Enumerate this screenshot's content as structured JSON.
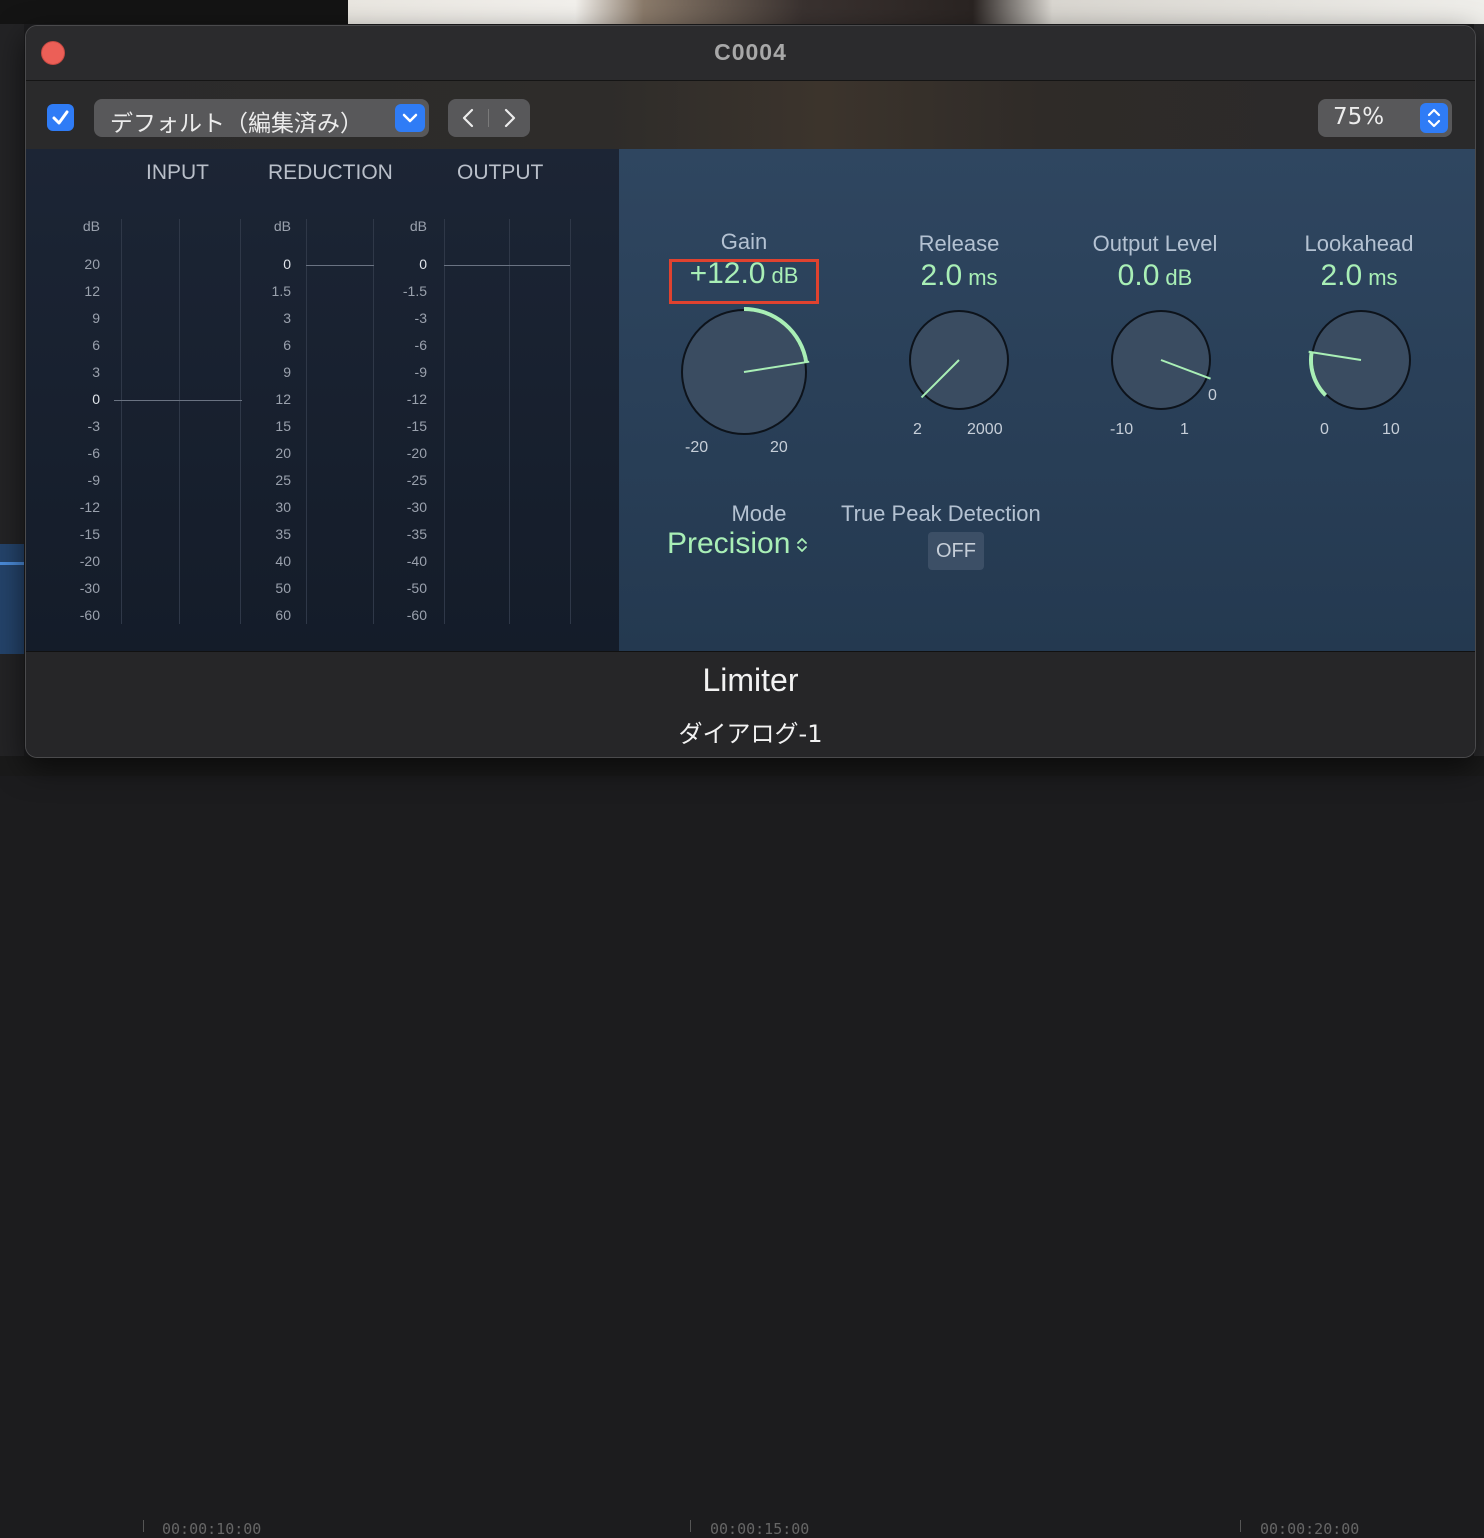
{
  "window": {
    "title": "C0004"
  },
  "toolbar": {
    "preset": "デフォルト（編集済み）",
    "zoom": "75%"
  },
  "meters": {
    "input_label": "INPUT",
    "reduction_label": "REDUCTION",
    "output_label": "OUTPUT",
    "unit": "dB",
    "input_scale": [
      "20",
      "12",
      "9",
      "6",
      "3",
      "0",
      "-3",
      "-6",
      "-9",
      "-12",
      "-15",
      "-20",
      "-30",
      "-60"
    ],
    "reduction_scale": [
      "0",
      "1.5",
      "3",
      "6",
      "9",
      "12",
      "15",
      "20",
      "25",
      "30",
      "35",
      "40",
      "50",
      "60"
    ],
    "output_scale": [
      "0",
      "-1.5",
      "-3",
      "-6",
      "-9",
      "-12",
      "-15",
      "-20",
      "-25",
      "-30",
      "-35",
      "-40",
      "-50",
      "-60"
    ]
  },
  "controls": {
    "gain": {
      "title": "Gain",
      "value": "+12.0",
      "unit": "dB",
      "min": "-20",
      "max": "20",
      "fraction": 0.8
    },
    "release": {
      "title": "Release",
      "value": "2.0",
      "unit": "ms",
      "min": "2",
      "max": "2000",
      "fraction": 0.0
    },
    "output_level": {
      "title": "Output Level",
      "value": "0.0",
      "unit": "dB",
      "min": "-10",
      "max": "1",
      "zero": "0",
      "fraction": 0.91
    },
    "lookahead": {
      "title": "Lookahead",
      "value": "2.0",
      "unit": "ms",
      "min": "0",
      "max": "10",
      "fraction": 0.2
    },
    "mode": {
      "title": "Mode",
      "value": "Precision"
    },
    "true_peak": {
      "title": "True Peak Detection",
      "value": "OFF"
    }
  },
  "footer": {
    "plugin_name": "Limiter",
    "track_name": "ダイアログ-1"
  },
  "timeline": {
    "timecodes": [
      "00:00:10:00",
      "00:00:15:00",
      "00:00:20:00"
    ]
  },
  "colors": {
    "accent_blue": "#2f7cf6",
    "value_green": "#a9efb6",
    "highlight_red": "#e0422f",
    "close_red": "#ec5f57"
  }
}
